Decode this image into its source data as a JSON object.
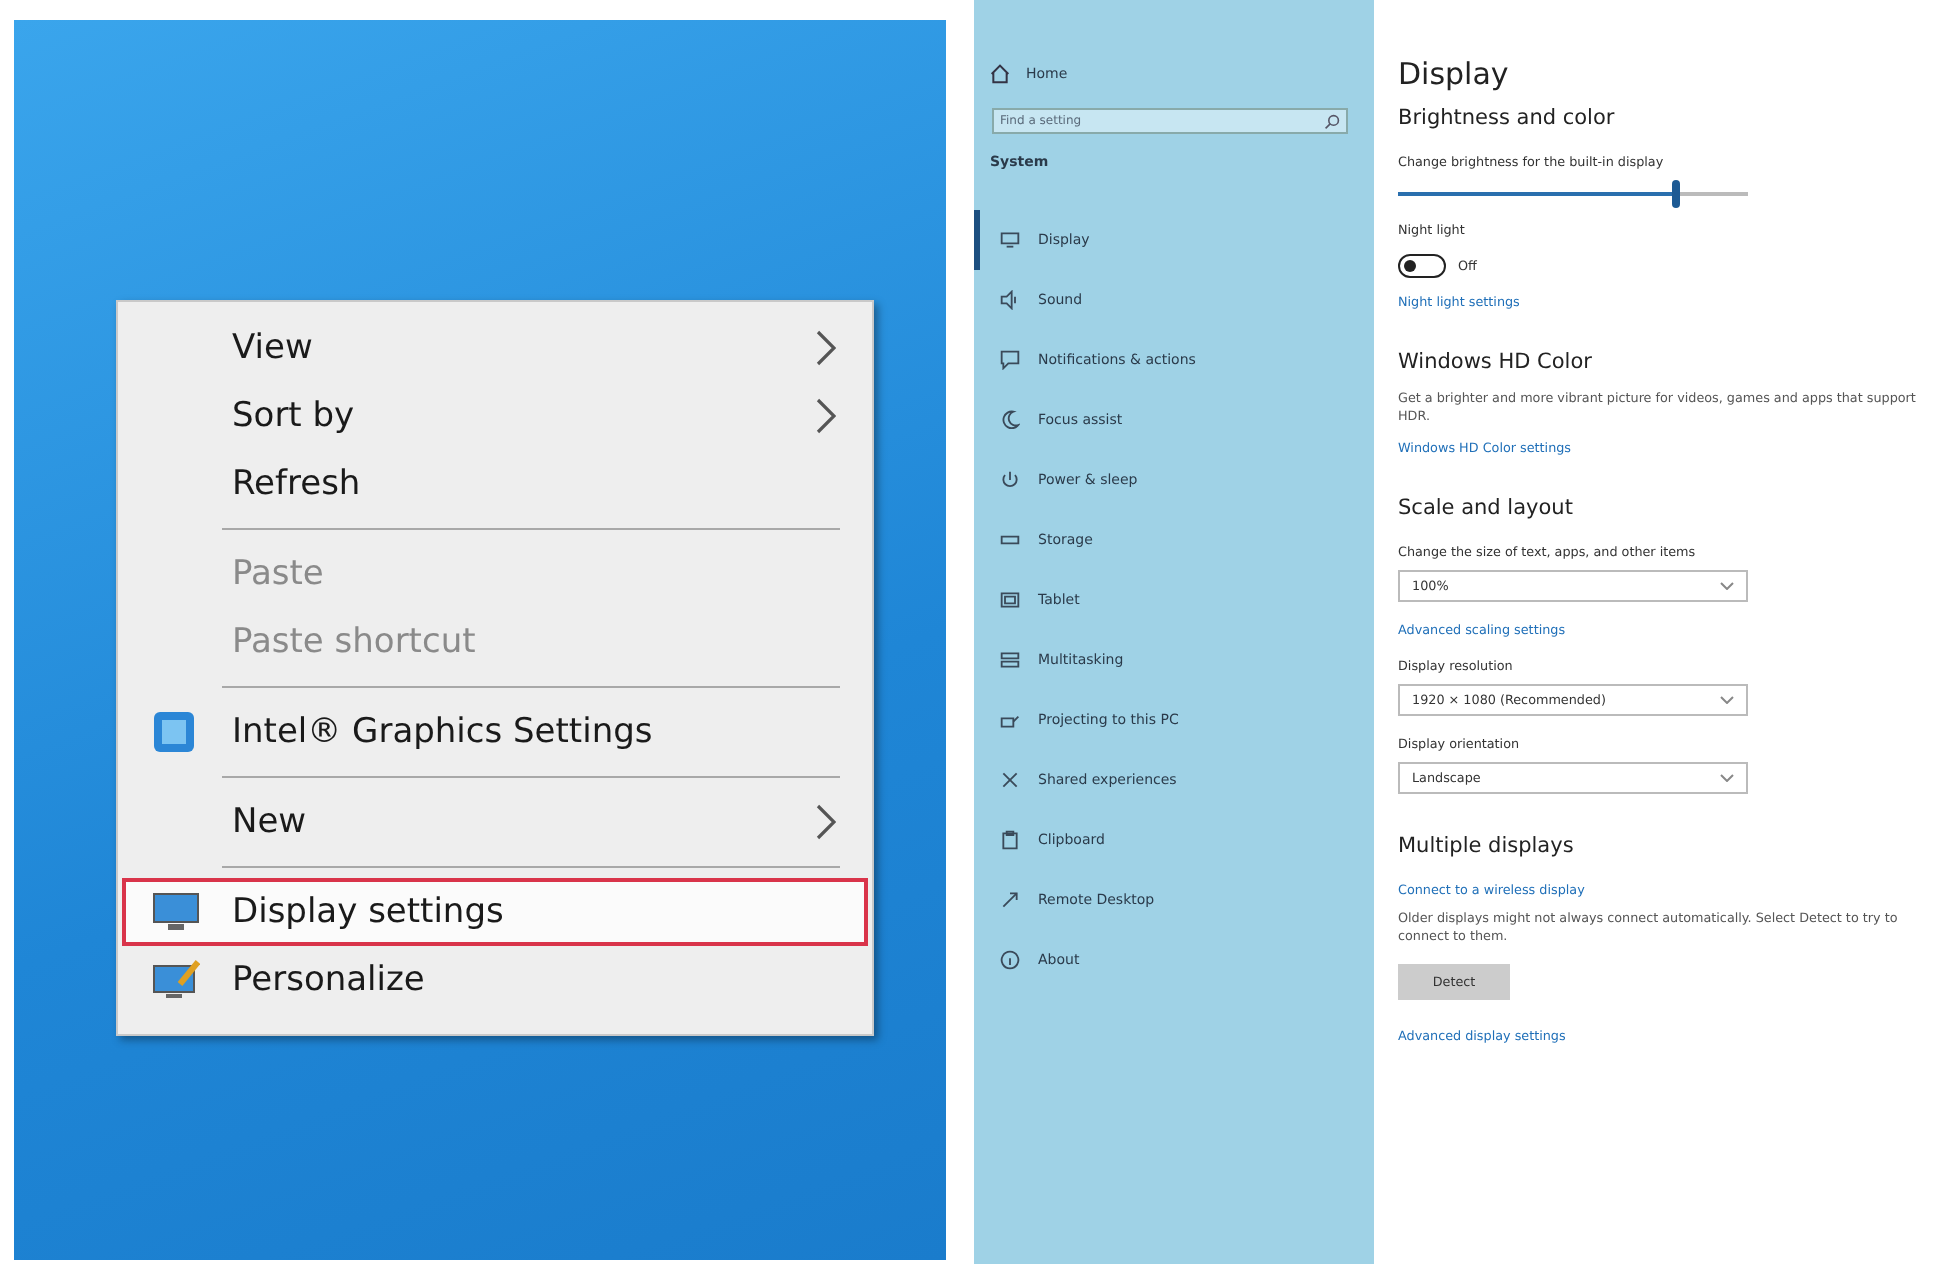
{
  "context_menu": {
    "groups": [
      [
        {
          "label": "View",
          "kind": "plain",
          "submenu": true,
          "disabled": false,
          "selected": false
        },
        {
          "label": "Sort by",
          "kind": "plain",
          "submenu": true,
          "disabled": false,
          "selected": false
        },
        {
          "label": "Refresh",
          "kind": "plain",
          "submenu": false,
          "disabled": false,
          "selected": false
        }
      ],
      [
        {
          "label": "Paste",
          "kind": "plain",
          "submenu": false,
          "disabled": true,
          "selected": false
        },
        {
          "label": "Paste shortcut",
          "kind": "plain",
          "submenu": false,
          "disabled": true,
          "selected": false
        }
      ],
      [
        {
          "label": "Intel® Graphics Settings",
          "kind": "graphics",
          "submenu": false,
          "disabled": false,
          "selected": false
        }
      ],
      [
        {
          "label": "New",
          "kind": "plain",
          "submenu": true,
          "disabled": false,
          "selected": false
        }
      ],
      [
        {
          "label": "Display settings",
          "kind": "display",
          "submenu": false,
          "disabled": false,
          "selected": true
        },
        {
          "label": "Personalize",
          "kind": "personalize",
          "submenu": false,
          "disabled": false,
          "selected": false
        }
      ]
    ]
  },
  "sidebar": {
    "home": "Home",
    "search": {
      "placeholder": "Find a setting"
    },
    "section": "System",
    "items": [
      {
        "label": "Display",
        "selected": true
      },
      {
        "label": "Sound",
        "selected": false
      },
      {
        "label": "Notifications & actions",
        "selected": false
      },
      {
        "label": "Focus assist",
        "selected": false
      },
      {
        "label": "Power & sleep",
        "selected": false
      },
      {
        "label": "Storage",
        "selected": false
      },
      {
        "label": "Tablet",
        "selected": false
      },
      {
        "label": "Multitasking",
        "selected": false
      },
      {
        "label": "Projecting to this PC",
        "selected": false
      },
      {
        "label": "Shared experiences",
        "selected": false
      },
      {
        "label": "Clipboard",
        "selected": false
      },
      {
        "label": "Remote Desktop",
        "selected": false
      },
      {
        "label": "About",
        "selected": false
      }
    ]
  },
  "content": {
    "title": "Display",
    "blocks": [
      {
        "kind": "heading",
        "text": "Brightness and color"
      },
      {
        "kind": "label",
        "text": "Change brightness for the built-in display"
      },
      {
        "kind": "slider",
        "level": 0.79
      },
      {
        "kind": "label",
        "text": "Night light"
      },
      {
        "kind": "toggle",
        "on": false,
        "text": "Off"
      },
      {
        "kind": "link",
        "text": "Night light settings"
      },
      {
        "kind": "heading",
        "text": "Windows HD Color"
      },
      {
        "kind": "text",
        "text": "Get a brighter and more vibrant picture for videos, games and apps that support HDR."
      },
      {
        "kind": "link",
        "text": "Windows HD Color settings"
      },
      {
        "kind": "heading",
        "text": "Scale and layout"
      },
      {
        "kind": "label",
        "text": "Change the size of text, apps, and other items"
      },
      {
        "kind": "dropdown",
        "value": "100%"
      },
      {
        "kind": "link",
        "text": "Advanced scaling settings"
      },
      {
        "kind": "label",
        "text": "Display resolution"
      },
      {
        "kind": "dropdown",
        "value": "1920 × 1080 (Recommended)"
      },
      {
        "kind": "label",
        "text": "Display orientation"
      },
      {
        "kind": "dropdown",
        "value": "Landscape"
      },
      {
        "kind": "heading",
        "text": "Multiple displays"
      },
      {
        "kind": "link",
        "text": "Connect to a wireless display"
      },
      {
        "kind": "text",
        "text": "Older displays might not always connect automatically. Select Detect to try to connect to them."
      },
      {
        "kind": "button",
        "text": "Detect"
      },
      {
        "kind": "link",
        "text": "Advanced display settings"
      }
    ]
  }
}
